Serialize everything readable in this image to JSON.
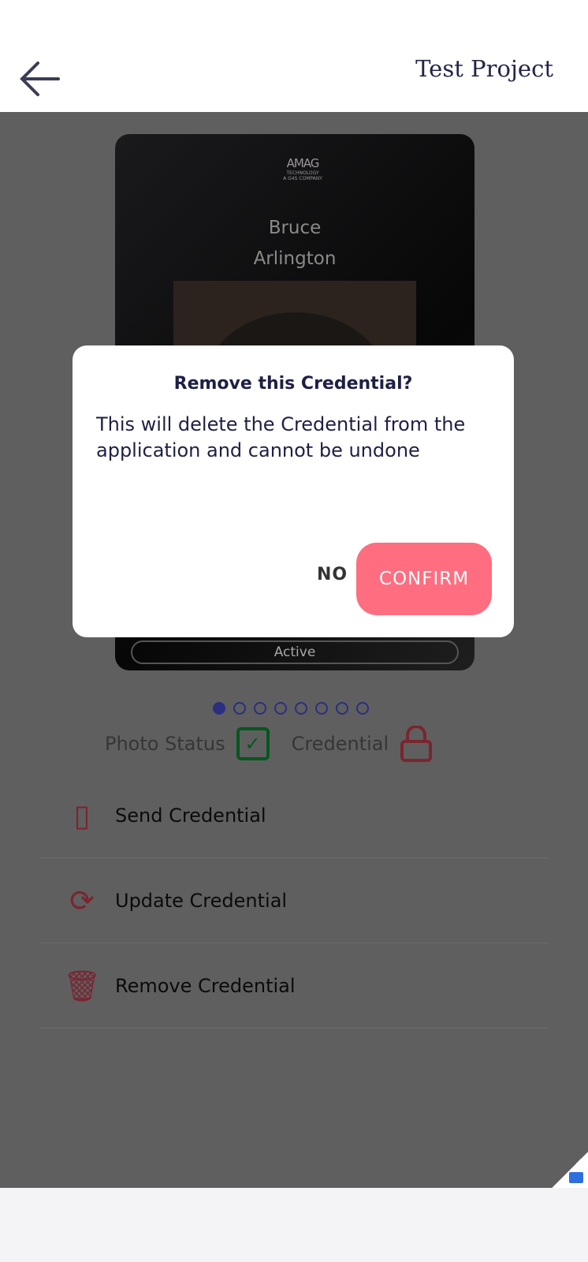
{
  "header": {
    "title": "Test Project",
    "back_icon": "arrow-left-icon"
  },
  "card": {
    "logo": {
      "main": "AMAG",
      "sub": "TECHNOLOGY",
      "tag": "A G4S COMPANY"
    },
    "first_name": "Bruce",
    "last_name": "Arlington",
    "status": "Active"
  },
  "pager": {
    "count": 8,
    "active": 1
  },
  "status_row": {
    "photo_label": "Photo Status",
    "credential_label": "Credential"
  },
  "actions": [
    {
      "label": "Send Credential",
      "icon": "card-hand-icon"
    },
    {
      "label": "Update Credential",
      "icon": "refresh-icon"
    },
    {
      "label": "Remove Credential",
      "icon": "trash-icon"
    }
  ],
  "dialog": {
    "title": "Remove this Credential?",
    "message": "This will delete the Credential from the application and cannot be undone",
    "no": "NO",
    "confirm": "CONFIRM"
  },
  "colors": {
    "accent": "#fe6e80",
    "title": "#232447",
    "dot": "#3a3fb0"
  }
}
